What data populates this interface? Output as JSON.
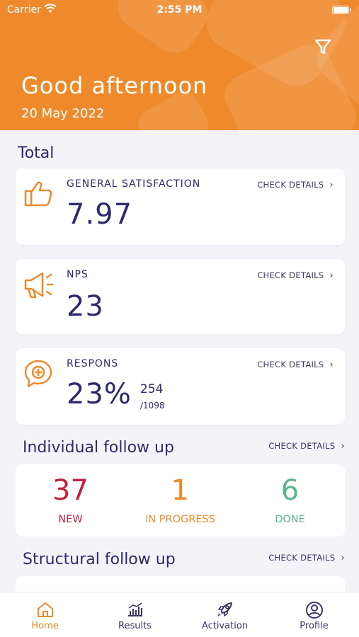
{
  "status": {
    "carrier": "Carrier",
    "time": "2:55 PM"
  },
  "header": {
    "greeting": "Good afternoon",
    "date": "20 May 2022"
  },
  "total": {
    "title": "Total",
    "cards": [
      {
        "label": "GENERAL SATISFACTION",
        "value": "7.97",
        "check": "CHECK DETAILS",
        "icon": "thumbs-up-icon"
      },
      {
        "label": "NPS",
        "value": "23",
        "check": "CHECK DETAILS",
        "icon": "megaphone-icon"
      },
      {
        "label": "RESPONS",
        "value": "23%",
        "count": "254",
        "total": "/1098",
        "check": "CHECK DETAILS",
        "icon": "chat-plus-icon"
      }
    ]
  },
  "individual": {
    "title": "Individual follow up",
    "check": "CHECK DETAILS",
    "stats": [
      {
        "value": "37",
        "label": "NEW",
        "color": "#c0233f"
      },
      {
        "value": "1",
        "label": "IN PROGRESS",
        "color": "#ef8a2c"
      },
      {
        "value": "6",
        "label": "DONE",
        "color": "#5bb58c"
      }
    ]
  },
  "structural": {
    "title": "Structural follow up",
    "check": "CHECK DETAILS"
  },
  "tabs": [
    {
      "label": "Home",
      "icon": "home-icon",
      "active": true
    },
    {
      "label": "Results",
      "icon": "chart-icon",
      "active": false
    },
    {
      "label": "Activation",
      "icon": "rocket-icon",
      "active": false
    },
    {
      "label": "Profile",
      "icon": "profile-icon",
      "active": false
    }
  ],
  "colors": {
    "accent": "#ef8a2c",
    "primary": "#2e2a6e",
    "background": "#f4f4f8"
  }
}
